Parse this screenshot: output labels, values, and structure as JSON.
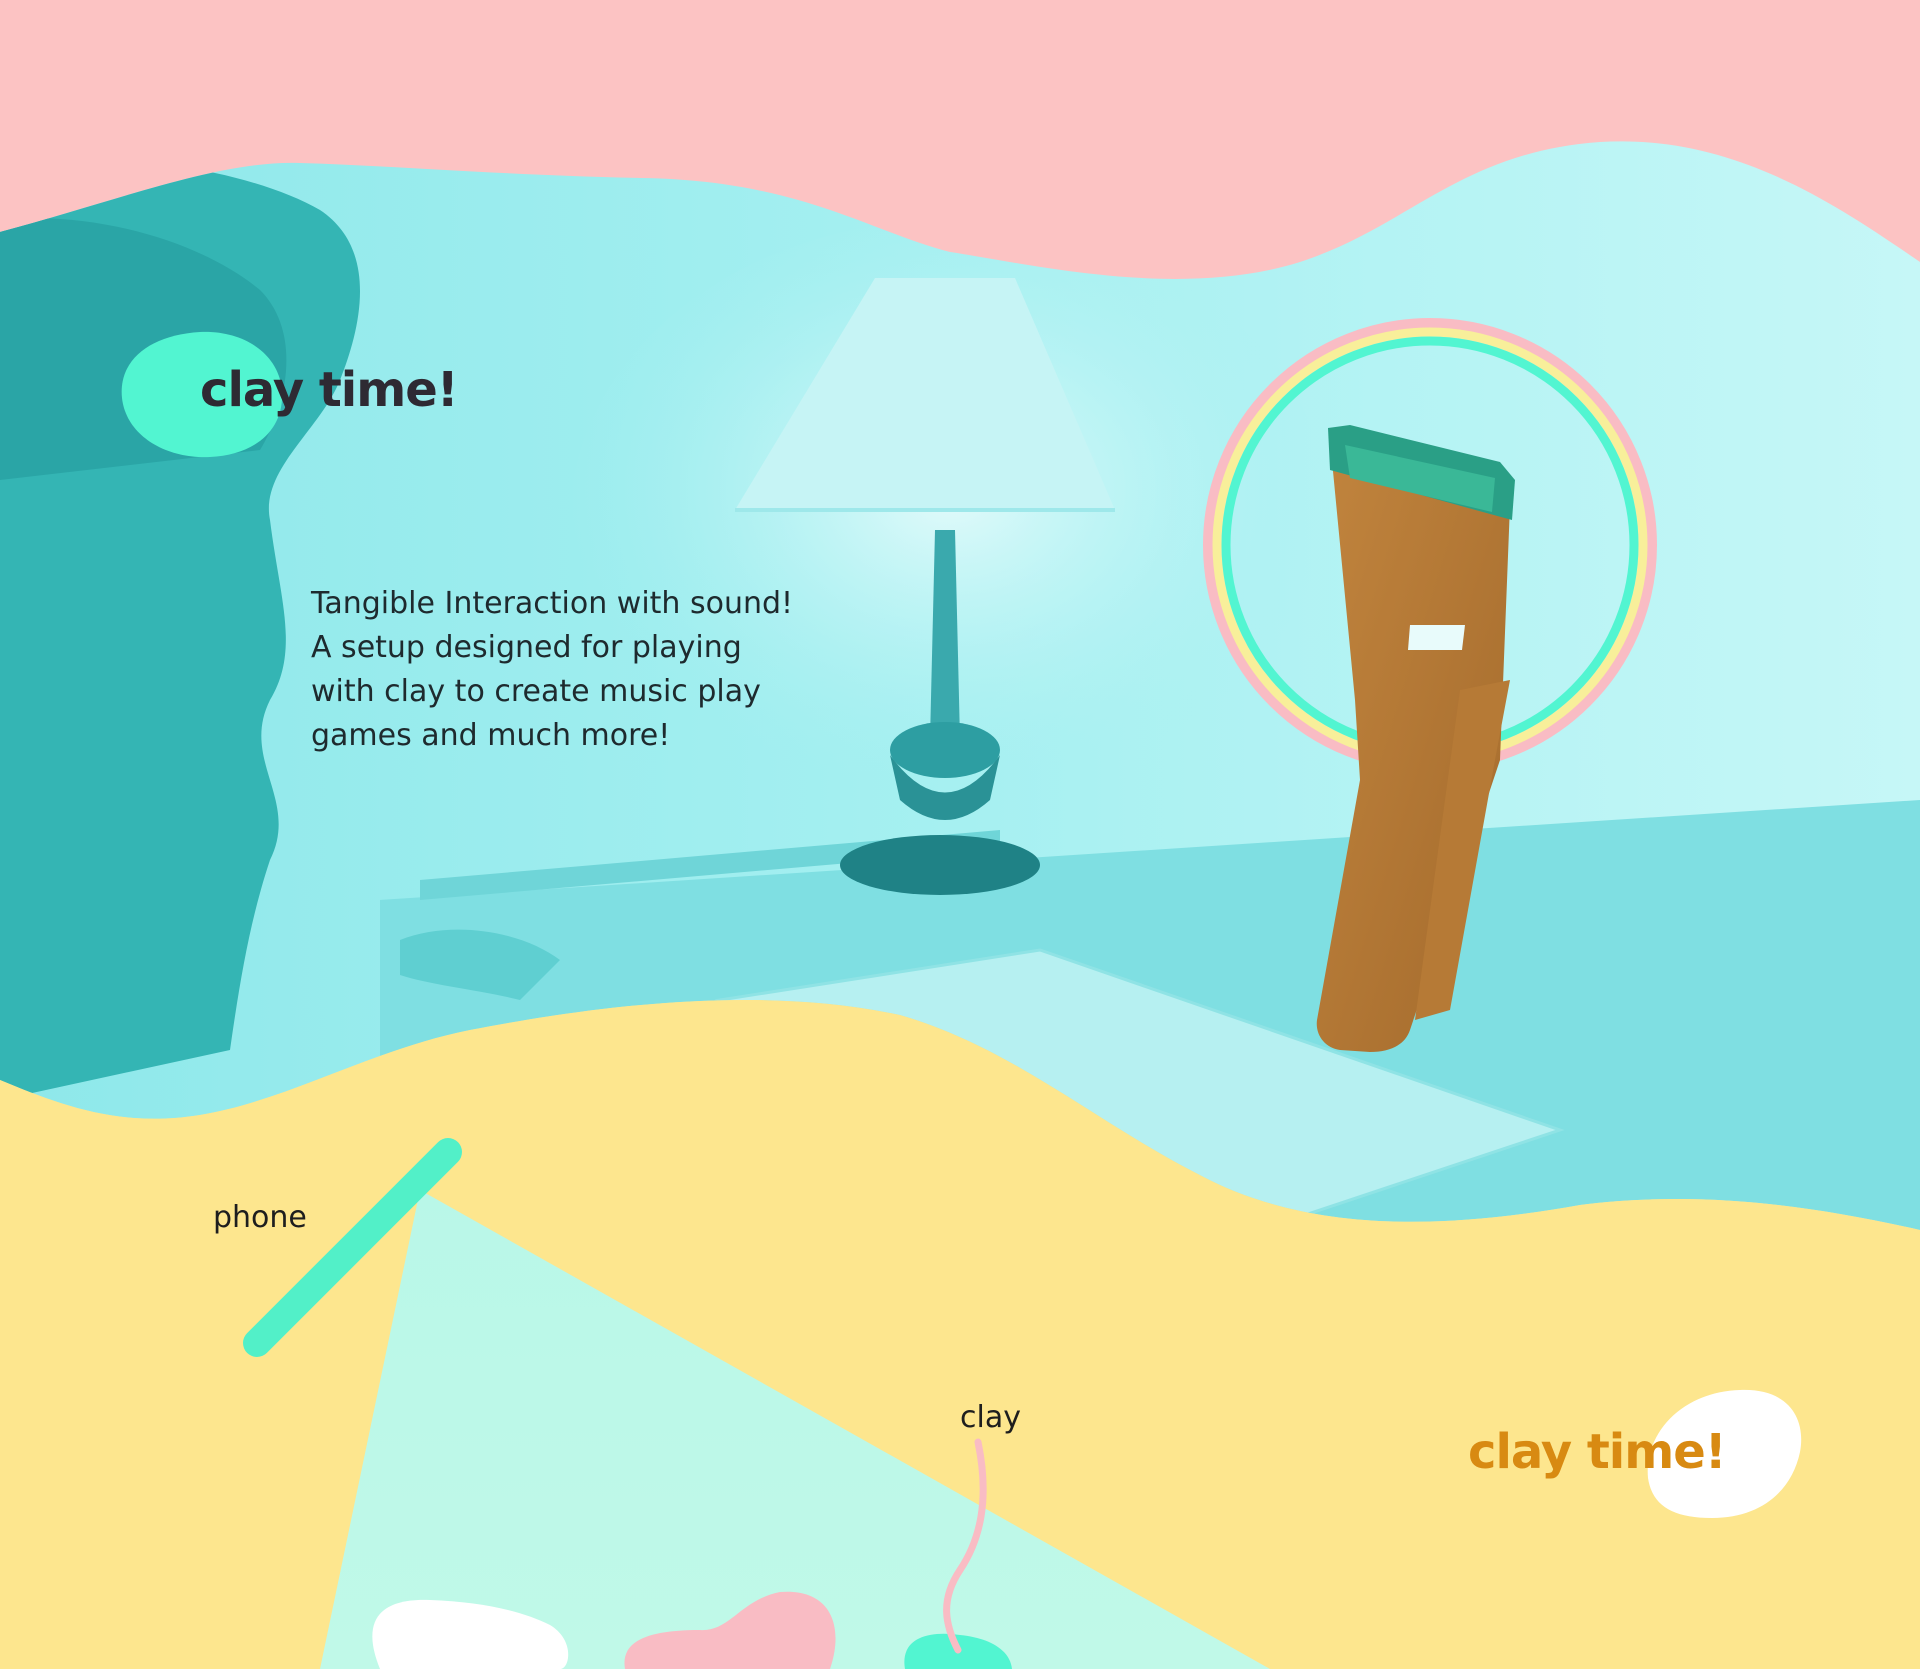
{
  "title_top": "clay time!",
  "intro_text": "Tangible Interaction with sound!\nA setup designed for playing\nwith clay to create music play\ngames and much more!",
  "diagram": {
    "phone_label": "phone",
    "clay_label": "clay"
  },
  "title_bottom": "clay time!",
  "colors": {
    "pink": "#fcc3c3",
    "cyan_photo": "#9beded",
    "yellow": "#fde68e",
    "mint": "#bcf8e6",
    "teal_blob": "#52f5d1",
    "title_dark": "#2e2a33",
    "title_orange": "#d88a12"
  }
}
